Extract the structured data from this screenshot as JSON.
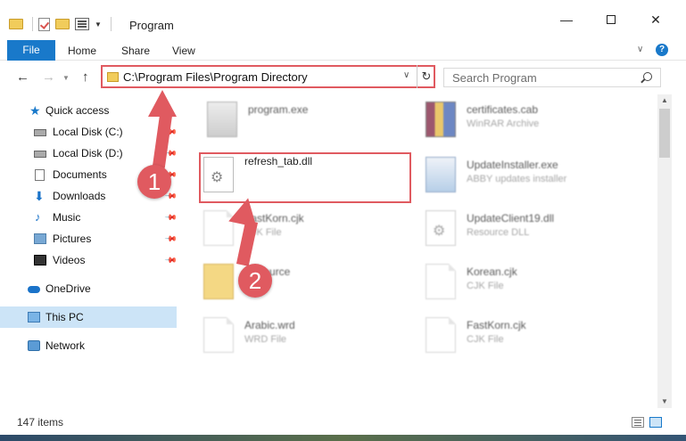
{
  "window": {
    "title": "Program",
    "min_glyph": "—",
    "close_glyph": "✕"
  },
  "ribbon": {
    "tabs": [
      "File",
      "Home",
      "Share",
      "View"
    ],
    "help_glyph": "?"
  },
  "address": {
    "path": "C:\\Program Files\\Program Directory",
    "refresh_glyph": "↻",
    "dropdown_glyph": "∨"
  },
  "search": {
    "placeholder": "Search Program"
  },
  "nav": {
    "items": [
      {
        "label": "Quick access",
        "icon": "star-icon",
        "pinned": false
      },
      {
        "label": "Local Disk (C:)",
        "icon": "drive-icon",
        "pinned": true
      },
      {
        "label": "Local Disk (D:)",
        "icon": "drive-icon",
        "pinned": true
      },
      {
        "label": "Documents",
        "icon": "documents-icon",
        "pinned": true
      },
      {
        "label": "Downloads",
        "icon": "downloads-icon",
        "pinned": true
      },
      {
        "label": "Music",
        "icon": "music-icon",
        "pinned": true
      },
      {
        "label": "Pictures",
        "icon": "pictures-icon",
        "pinned": true
      },
      {
        "label": "Videos",
        "icon": "videos-icon",
        "pinned": true
      },
      {
        "label": "OneDrive",
        "icon": "onedrive-icon",
        "pinned": false
      },
      {
        "label": "This PC",
        "icon": "this-pc-icon",
        "pinned": false,
        "selected": true
      },
      {
        "label": "Network",
        "icon": "network-icon",
        "pinned": false
      }
    ]
  },
  "files": [
    {
      "name": "program.exe",
      "type": "",
      "icon": "exe-icon"
    },
    {
      "name": "certificates.cab",
      "type": "WinRAR Archive",
      "icon": "cab-archive-icon"
    },
    {
      "name": "refresh_tab.dll",
      "type": "",
      "icon": "dll-gear-icon"
    },
    {
      "name": "UpdateInstaller.exe",
      "type": "ABBY updates installer",
      "icon": "installer-icon"
    },
    {
      "name": "FastKorn.cjk",
      "type": "CJK File",
      "icon": "blank-file-icon"
    },
    {
      "name": "UpdateClient19.dll",
      "type": "Resource DLL",
      "icon": "dll-gear-icon"
    },
    {
      "name": "Resource",
      "type": "",
      "icon": "folder-icon"
    },
    {
      "name": "Korean.cjk",
      "type": "CJK File",
      "icon": "blank-file-icon"
    },
    {
      "name": "Arabic.wrd",
      "type": "WRD File",
      "icon": "blank-file-icon"
    },
    {
      "name": "FastKorn.cjk",
      "type": "CJK File",
      "icon": "blank-file-icon"
    }
  ],
  "callouts": [
    "1",
    "2"
  ],
  "status": {
    "item_count": "147 items"
  },
  "colors": {
    "accent": "#1979ca",
    "highlight": "#e05a60",
    "selection": "#cce4f7"
  }
}
